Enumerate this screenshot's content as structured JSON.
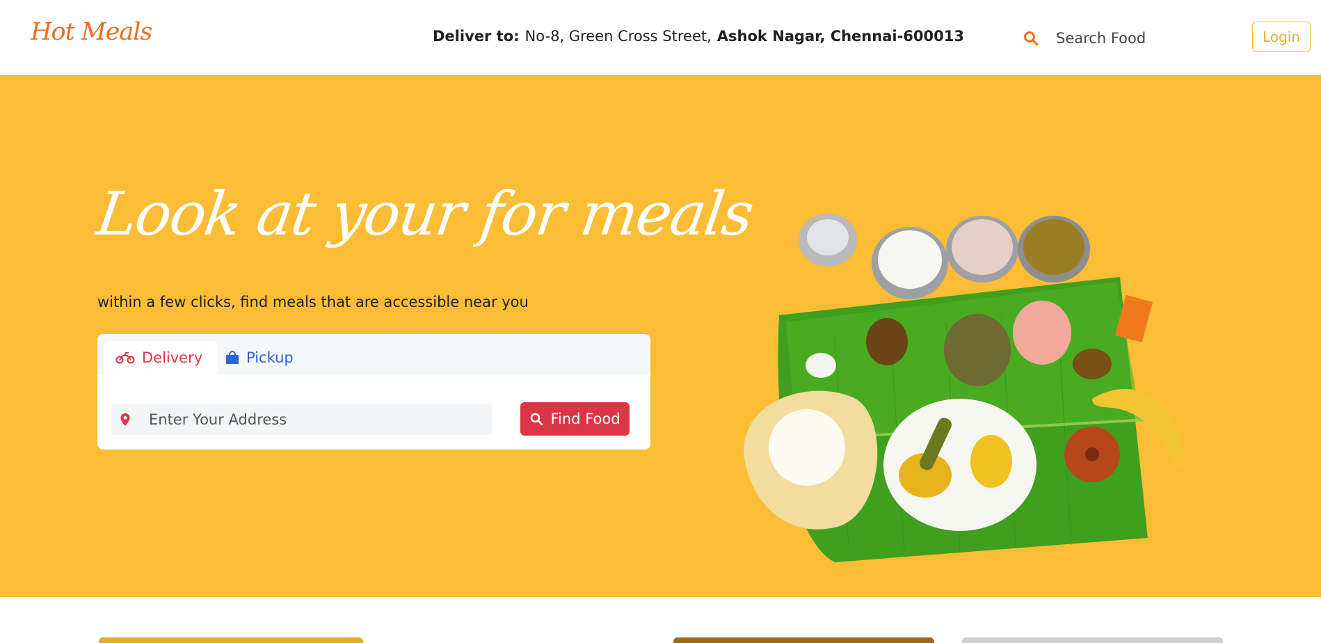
{
  "header": {
    "logo": "Hot Meals",
    "deliver_label": "Deliver to:",
    "deliver_address_line": "No-8, Green Cross Street,",
    "deliver_address_area": "Ashok Nagar, Chennai-600013",
    "search_label": "Search Food",
    "login_label": "Login"
  },
  "hero": {
    "title": "Look at your for meals",
    "subtitle": "within a few clicks, find meals that are accessible near you",
    "tabs": [
      {
        "label": "Delivery",
        "icon": "motorcycle-icon",
        "active": true
      },
      {
        "label": "Pickup",
        "icon": "shopping-bag-icon",
        "active": false
      }
    ],
    "address_placeholder": "Enter Your Address",
    "find_button": "Find Food"
  },
  "colors": {
    "brand": "#ee6d22",
    "hero_bg": "#fbbd35",
    "accent_red": "#dc3545",
    "pickup_blue": "#2f63d8",
    "login_border": "#f6bd2f"
  }
}
